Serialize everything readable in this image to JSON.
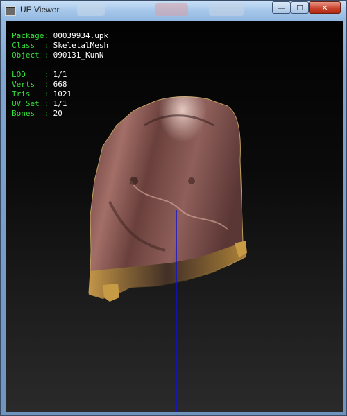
{
  "window": {
    "title": "UE Viewer",
    "minimize_symbol": "—",
    "maximize_symbol": "☐",
    "close_symbol": "✕"
  },
  "info": {
    "rows1": [
      {
        "label": "Package: ",
        "value": "00039934.upk"
      },
      {
        "label": "Class  : ",
        "value": "SkeletalMesh"
      },
      {
        "label": "Object : ",
        "value": "090131_KunN"
      }
    ],
    "rows2": [
      {
        "label": "LOD    : ",
        "value": "1/1"
      },
      {
        "label": "Verts  : ",
        "value": "668"
      },
      {
        "label": "Tris   : ",
        "value": "1021"
      },
      {
        "label": "UV Set : ",
        "value": "1/1"
      },
      {
        "label": "Bones  : ",
        "value": "20"
      }
    ]
  },
  "colors": {
    "label": "#36e03a",
    "value": "#ffffff",
    "axis": "#1010d8",
    "cloth": "#8a5a58",
    "trim": "#b58a3a"
  },
  "icons": [
    "app-icon",
    "minimize-icon",
    "maximize-icon",
    "close-icon"
  ]
}
